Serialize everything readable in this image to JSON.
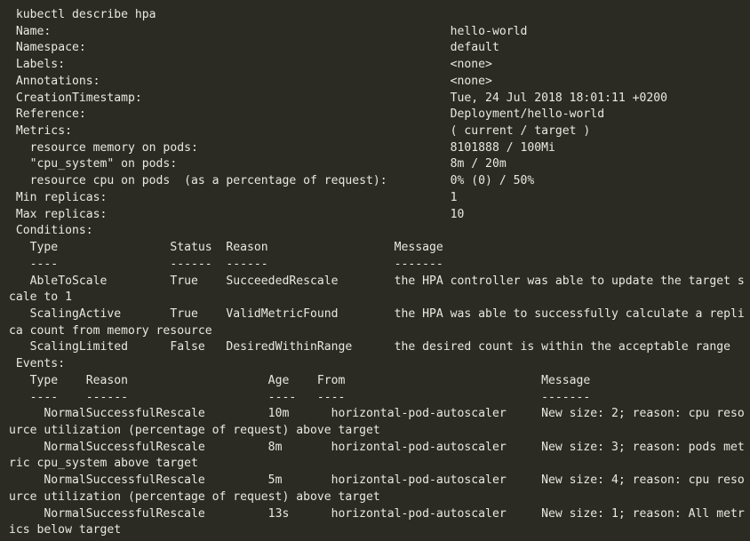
{
  "terminal": {
    "background_color": "#2b2b24",
    "foreground_color": "#e9e9e1",
    "command": "kubectl describe hpa",
    "fields": [
      {
        "label": "Name:",
        "value": "hello-world"
      },
      {
        "label": "Namespace:",
        "value": "default"
      },
      {
        "label": "Labels:",
        "value": "<none>"
      },
      {
        "label": "Annotations:",
        "value": "<none>"
      },
      {
        "label": "CreationTimestamp:",
        "value": "Tue, 24 Jul 2018 18:01:11 +0200"
      },
      {
        "label": "Reference:",
        "value": "Deployment/hello-world"
      },
      {
        "label": "Metrics:",
        "value": "( current / target )"
      },
      {
        "label": "  resource memory on pods:",
        "value": "8101888 / 100Mi"
      },
      {
        "label": "  \"cpu_system\" on pods:",
        "value": "8m / 20m"
      },
      {
        "label": "  resource cpu on pods  (as a percentage of request):",
        "value": "0% (0) / 50%"
      },
      {
        "label": "Min replicas:",
        "value": "1"
      },
      {
        "label": "Max replicas:",
        "value": "10"
      },
      {
        "label": "Conditions:",
        "value": ""
      }
    ],
    "conditions": {
      "headers": [
        "Type",
        "Status",
        "Reason",
        "Message"
      ],
      "underlines": [
        "----",
        "------",
        "------",
        "-------"
      ],
      "rows": [
        {
          "type": "AbleToScale",
          "status": "True",
          "reason": "SucceededRescale",
          "message": "the HPA controller was able to update the target scale to 1"
        },
        {
          "type": "ScalingActive",
          "status": "True",
          "reason": "ValidMetricFound",
          "message": "the HPA was able to successfully calculate a replica count from memory resource"
        },
        {
          "type": "ScalingLimited",
          "status": "False",
          "reason": "DesiredWithinRange",
          "message": "the desired count is within the acceptable range"
        }
      ]
    },
    "events": {
      "section_label": "Events:",
      "headers": [
        "Type",
        "Reason",
        "Age",
        "From",
        "Message"
      ],
      "underlines": [
        "----",
        "------",
        "----",
        "----",
        "-------"
      ],
      "rows": [
        {
          "type": "Normal",
          "reason": "SuccessfulRescale",
          "age": "10m",
          "from": "horizontal-pod-autoscaler",
          "message": "New size: 2; reason: cpu resource utilization (percentage of request) above target"
        },
        {
          "type": "Normal",
          "reason": "SuccessfulRescale",
          "age": "8m",
          "from": "horizontal-pod-autoscaler",
          "message": "New size: 3; reason: pods metric cpu_system above target"
        },
        {
          "type": "Normal",
          "reason": "SuccessfulRescale",
          "age": "5m",
          "from": "horizontal-pod-autoscaler",
          "message": "New size: 4; reason: cpu resource utilization (percentage of request) above target"
        },
        {
          "type": "Normal",
          "reason": "SuccessfulRescale",
          "age": "13s",
          "from": "horizontal-pod-autoscaler",
          "message": "New size: 1; reason: All metrics below target"
        }
      ]
    }
  }
}
